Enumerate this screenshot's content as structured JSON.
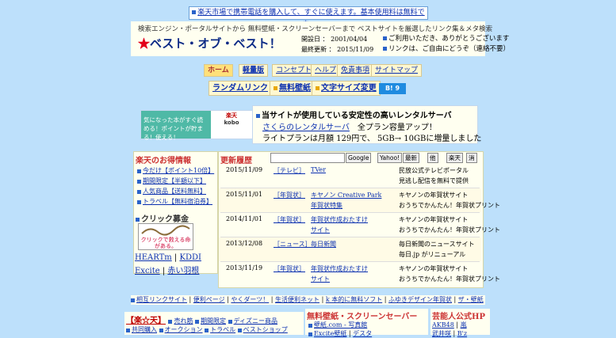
{
  "top_banner": "楽天市場で携帯電話を購入して、すぐに使えます。基本使用料は無料です。",
  "header": {
    "tagline": "検索エンジン・ポータルサイトから 無料壁紙・スクリーンセーバーまで ベストサイトを厳選したリンク集＆メタ検索",
    "logo_star": "★",
    "logo": "ベスト・オブ・ベスト！",
    "open_label": "開設日 ： 2001/04/04",
    "update_label": "最終更新 ： 2015/11/09",
    "note1": "ご利用いただき、ありがとうございます",
    "note2": "リンクは、ご自由にどうぞ（連絡不要）"
  },
  "nav": {
    "home": "ホーム",
    "light": "軽量版",
    "concept": "コンセプト",
    "help": "ヘルプ",
    "disclaimer": "免責事項",
    "sitemap": "サイトマップ"
  },
  "actions": {
    "random_link": "ランダムリンク",
    "free_wallpaper": "無料壁紙",
    "font_size": "文字サイズ変更",
    "hatena": "B! 9"
  },
  "kobo_ad": {
    "text": "気になった本がすぐ読める！ポイントが貯まる！使える！",
    "brand1": "楽天",
    "brand2": "kobo"
  },
  "server_ad": {
    "title": "当サイトが使用している安定性の高いレンタルサーバ",
    "link": "さくらのレンタルサーバ",
    "line1_rest": "全プラン容量アップ！",
    "line2": "ライトプランは月額 129円で、 5GB→ 10GBに増量しました"
  },
  "rakuten_info": {
    "title": "楽天のお得情報",
    "items": [
      "今だけ【ポイント10倍】",
      "期間限定【半額以下】",
      "人気商品【送料無料】",
      "トラベル【無料宿泊券】"
    ]
  },
  "click_bokin": {
    "title": "クリック募金",
    "img_text": "クリックで救える命がある。",
    "links": [
      "HEARTm",
      "KDDI",
      "Excite",
      "赤い羽根"
    ]
  },
  "updates": {
    "title": "更新履歴",
    "search_buttons": [
      "Google",
      "Yahoo!",
      "最新",
      "他",
      "楽天",
      "消"
    ],
    "rows": [
      {
        "date": "2015/11/09",
        "cat": "［テレビ］",
        "site1": "TVer",
        "site2": "",
        "desc1": "民放公式テレビポータル",
        "desc2": "見逃し配信を無料で提供"
      },
      {
        "date": "2015/11/01",
        "cat": "［年賀状］",
        "site1": "キヤノン Creative Park",
        "site2": "年賀状特集",
        "desc1": "キヤノンの年賀状サイト",
        "desc2": "おうちでかんたん！年賀状プリント"
      },
      {
        "date": "2014/11/01",
        "cat": "［年賀状］",
        "site1": "年賀状作成おたすけ",
        "site2": "サイト",
        "desc1": "キヤノンの年賀状サイト",
        "desc2": "おうちでかんたん！年賀状プリント"
      },
      {
        "date": "2013/12/08",
        "cat": "［ニュース］",
        "site1": "毎日新聞",
        "site2": "",
        "desc1": "毎日新聞のニュースサイト",
        "desc2": "毎日.jp がリニューアル"
      },
      {
        "date": "2013/11/19",
        "cat": "［年賀状］",
        "site1": "年賀状作成おたすけ",
        "site2": "サイト",
        "desc1": "キヤノンの年賀状サイト",
        "desc2": "おうちでかんたん！年賀状プリント"
      }
    ]
  },
  "link_bar": [
    "相互リンクサイト",
    "便利ページ",
    "やくダーツ！",
    "生活便利ネット",
    "k 本的に無料ソフト",
    "ふゆきデザイン年賀状",
    "ザ・壁紙"
  ],
  "rakuten_box": {
    "title": "【楽☆天】",
    "row1": [
      "売れ筋",
      "期間限定",
      "ディズニー商品"
    ],
    "row2": [
      "共同購入",
      "オークション",
      "トラベル",
      "ベストショップ"
    ]
  },
  "wallpaper_box": {
    "title": "無料壁紙・スクリーンセーバー",
    "links": [
      "壁紙.com - 写真館",
      "Excite壁紙",
      "デスタ"
    ]
  },
  "celebrity_box": {
    "title": "芸能人公式HP",
    "links": [
      "AKB48",
      "嵐",
      "武井咲",
      "B'z"
    ]
  }
}
